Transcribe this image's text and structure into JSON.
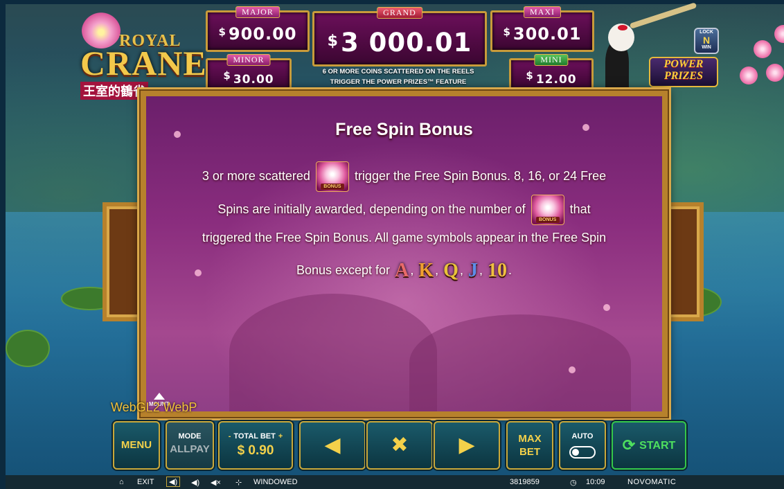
{
  "header": {
    "logo": {
      "line1": "ROYAL",
      "line2": "CRANE",
      "chinese": "王室的鶴雀"
    },
    "jackpots": {
      "major": {
        "label": "MAJOR",
        "currency": "$",
        "value": "900.00"
      },
      "minor": {
        "label": "MINOR",
        "currency": "$",
        "value": "30.00"
      },
      "grand": {
        "label": "GRAND",
        "currency": "$",
        "value": "3 000.01"
      },
      "maxi": {
        "label": "MAXI",
        "currency": "$",
        "value": "300.01"
      },
      "mini": {
        "label": "MINI",
        "currency": "$",
        "value": "12.00"
      }
    },
    "trigger_text": [
      "6 OR MORE COINS SCATTERED ON THE REELS",
      "TRIGGER THE POWER PRIZES™ FEATURE"
    ],
    "lock_badge": {
      "top": "LOCK",
      "mid": "N",
      "bottom": "WIN"
    },
    "power_prizes": [
      "POWER",
      "PRIZES"
    ]
  },
  "paytable": {
    "title": "Free Spin Bonus",
    "bonus_symbol_label": "BONUS",
    "line1": {
      "before": "3 or more scattered",
      "after": "trigger the Free Spin Bonus. 8, 16, or 24 Free"
    },
    "line2": {
      "before": "Spins are initially awarded, depending on the number of",
      "after": "that"
    },
    "line3": "triggered the Free Spin Bonus. All game symbols appear in the Free Spin",
    "line4": {
      "before": "Bonus except for",
      "end": "."
    },
    "excluded_symbols": [
      {
        "glyph": "A",
        "color": "#e86a6a"
      },
      {
        "glyph": "K",
        "color": "#f0a030"
      },
      {
        "glyph": "Q",
        "color": "#e8c23a"
      },
      {
        "glyph": "J",
        "color": "#5c8de8"
      },
      {
        "glyph": "10",
        "color": "#f0c040"
      }
    ],
    "separator": ",",
    "mount_logo": "MOUNT"
  },
  "overlay": {
    "renderer": "WebGL2  WebP"
  },
  "controls": {
    "menu": "MENU",
    "mode_label": "MODE",
    "mode_value": "ALLPAY",
    "total_bet_label": "TOTAL BET",
    "minus": "-",
    "plus": "+",
    "total_bet_value": "$ 0.90",
    "prev_glyph": "◀",
    "close_glyph": "✖",
    "next_glyph": "▶",
    "max_bet": [
      "MAX",
      "BET"
    ],
    "auto_label": "AUTO",
    "start": "START"
  },
  "status_bar": {
    "exit": "EXIT",
    "windowed": "WINDOWED",
    "game_id": "3819859",
    "time": "10:09",
    "brand": "NOVOMATIC"
  }
}
